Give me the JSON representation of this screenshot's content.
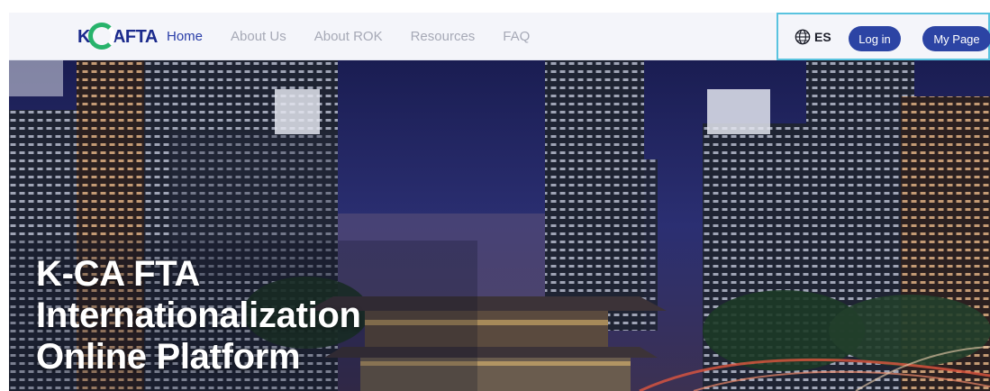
{
  "header": {
    "logo_text_left": "K",
    "logo_text_right": "AFTA",
    "nav": [
      {
        "label": "Home",
        "active": true
      },
      {
        "label": "About Us",
        "active": false
      },
      {
        "label": "About ROK",
        "active": false
      },
      {
        "label": "Resources",
        "active": false
      },
      {
        "label": "FAQ",
        "active": false
      }
    ],
    "language": {
      "icon": "globe-icon",
      "label": "ES"
    },
    "login_label": "Log in",
    "mypage_label": "My Page"
  },
  "hero": {
    "title_lines": [
      "K-CA FTA",
      "Internationalization",
      "Online Platform"
    ]
  },
  "colors": {
    "brand_blue": "#2c44a4",
    "brand_green": "#27b36b",
    "highlight_border": "#59c3df"
  }
}
